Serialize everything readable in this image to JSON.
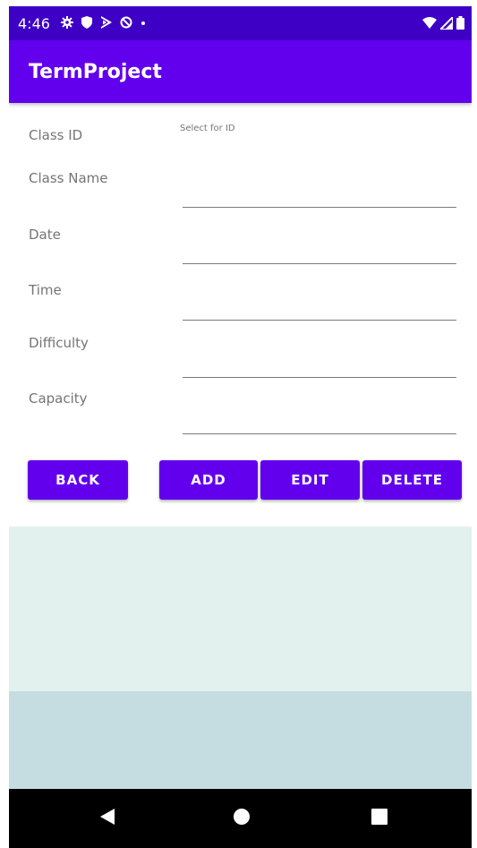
{
  "status_bar": {
    "time": "4:46",
    "left_icons": [
      "settings-icon",
      "shield-icon",
      "play-store-icon",
      "data-saver-icon",
      "dot-icon"
    ],
    "right_icons": [
      "wifi-icon",
      "signal-icon",
      "battery-icon"
    ]
  },
  "app_bar": {
    "title": "TermProject",
    "color": "#6200ee"
  },
  "form": {
    "class_id_label": "Class ID",
    "class_id_hint": "Select for ID",
    "class_name_label": "Class Name",
    "date_label": "Date",
    "time_label": "Time",
    "difficulty_label": "Difficulty",
    "capacity_label": "Capacity"
  },
  "buttons": {
    "back": "BACK",
    "add": "ADD",
    "edit": "EDIT",
    "delete": "DELETE"
  },
  "colors": {
    "status_bar": "#3f00c6",
    "accent": "#6200ee",
    "panel_light": "#e2f1ee",
    "panel_dark": "#c5dde0"
  },
  "nav_bar": {
    "buttons": [
      "back-triangle-icon",
      "home-circle-icon",
      "recents-square-icon"
    ]
  }
}
